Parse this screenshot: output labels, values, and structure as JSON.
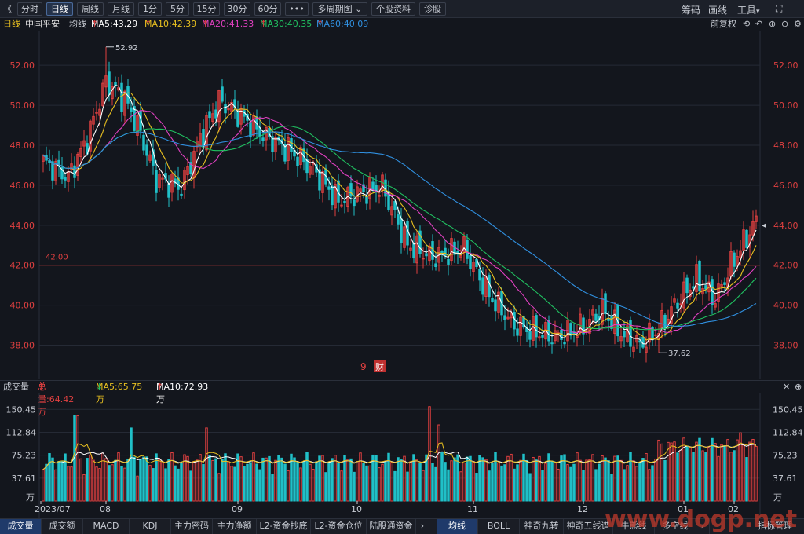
{
  "toolbar": {
    "collapse": "《",
    "periods": [
      "分时",
      "日线",
      "周线",
      "月线",
      "1分",
      "5分",
      "15分",
      "30分",
      "60分",
      "•••"
    ],
    "active_period": "日线",
    "multi_period": "多周期图",
    "stock_info": "个股资料",
    "diagnose": "诊股",
    "right": [
      "筹码",
      "画线",
      "工具"
    ]
  },
  "info": {
    "period": "日线",
    "name": "中国平安",
    "ma_label": "均线",
    "ma5": "MA5:43.29",
    "ma10": "MA10:42.39",
    "ma20": "MA20:41.33",
    "ma30": "MA30:40.35",
    "ma60": "MA60:40.09",
    "adjust": "前复权"
  },
  "colors": {
    "up": "#e04040",
    "down": "#20c0c8",
    "ma5": "#ffffff",
    "ma10": "#e8c020",
    "ma20": "#e040c0",
    "ma30": "#20c060",
    "ma60": "#3090e0",
    "axis_text": "#e04040",
    "grid": "#252a35"
  },
  "chart_data": {
    "type": "candlestick",
    "ylim": [
      37,
      53.5
    ],
    "yticks": [
      "52.00",
      "50.00",
      "48.00",
      "46.00",
      "44.00",
      "42.00",
      "40.00",
      "38.00"
    ],
    "ytick_values": [
      52,
      50,
      48,
      46,
      44,
      42,
      40,
      38
    ],
    "xticks": [
      "2023/07",
      "08",
      "09",
      "10",
      "11",
      "12",
      "01",
      "02"
    ],
    "high_label": "52.92",
    "low_label": "37.62",
    "hline_label": "42.00",
    "hline_value": 42,
    "marker_p": "9",
    "marker_cai": "财",
    "volume": {
      "title": "成交量",
      "total": "总量:64.42万",
      "ma5": "MA5:65.75万",
      "ma10": "MA10:72.93万",
      "yticks": [
        "150.45",
        "112.84",
        "75.23",
        "37.61"
      ],
      "ytick_values": [
        150.45,
        112.84,
        75.23,
        37.61
      ],
      "unit": "万"
    }
  },
  "bottom_tabs": {
    "left": [
      "成交量",
      "成交额",
      "MACD",
      "KDJ",
      "主力密码",
      "主力净额",
      "L2-资金抄底",
      "L2-资金仓位",
      "陆股通资金"
    ],
    "right": [
      "均线",
      "BOLL",
      "神奇九转",
      "神奇五线谱",
      "牛熊线",
      "多空线",
      "指标管理"
    ]
  },
  "watermark": "www.dogp.net"
}
